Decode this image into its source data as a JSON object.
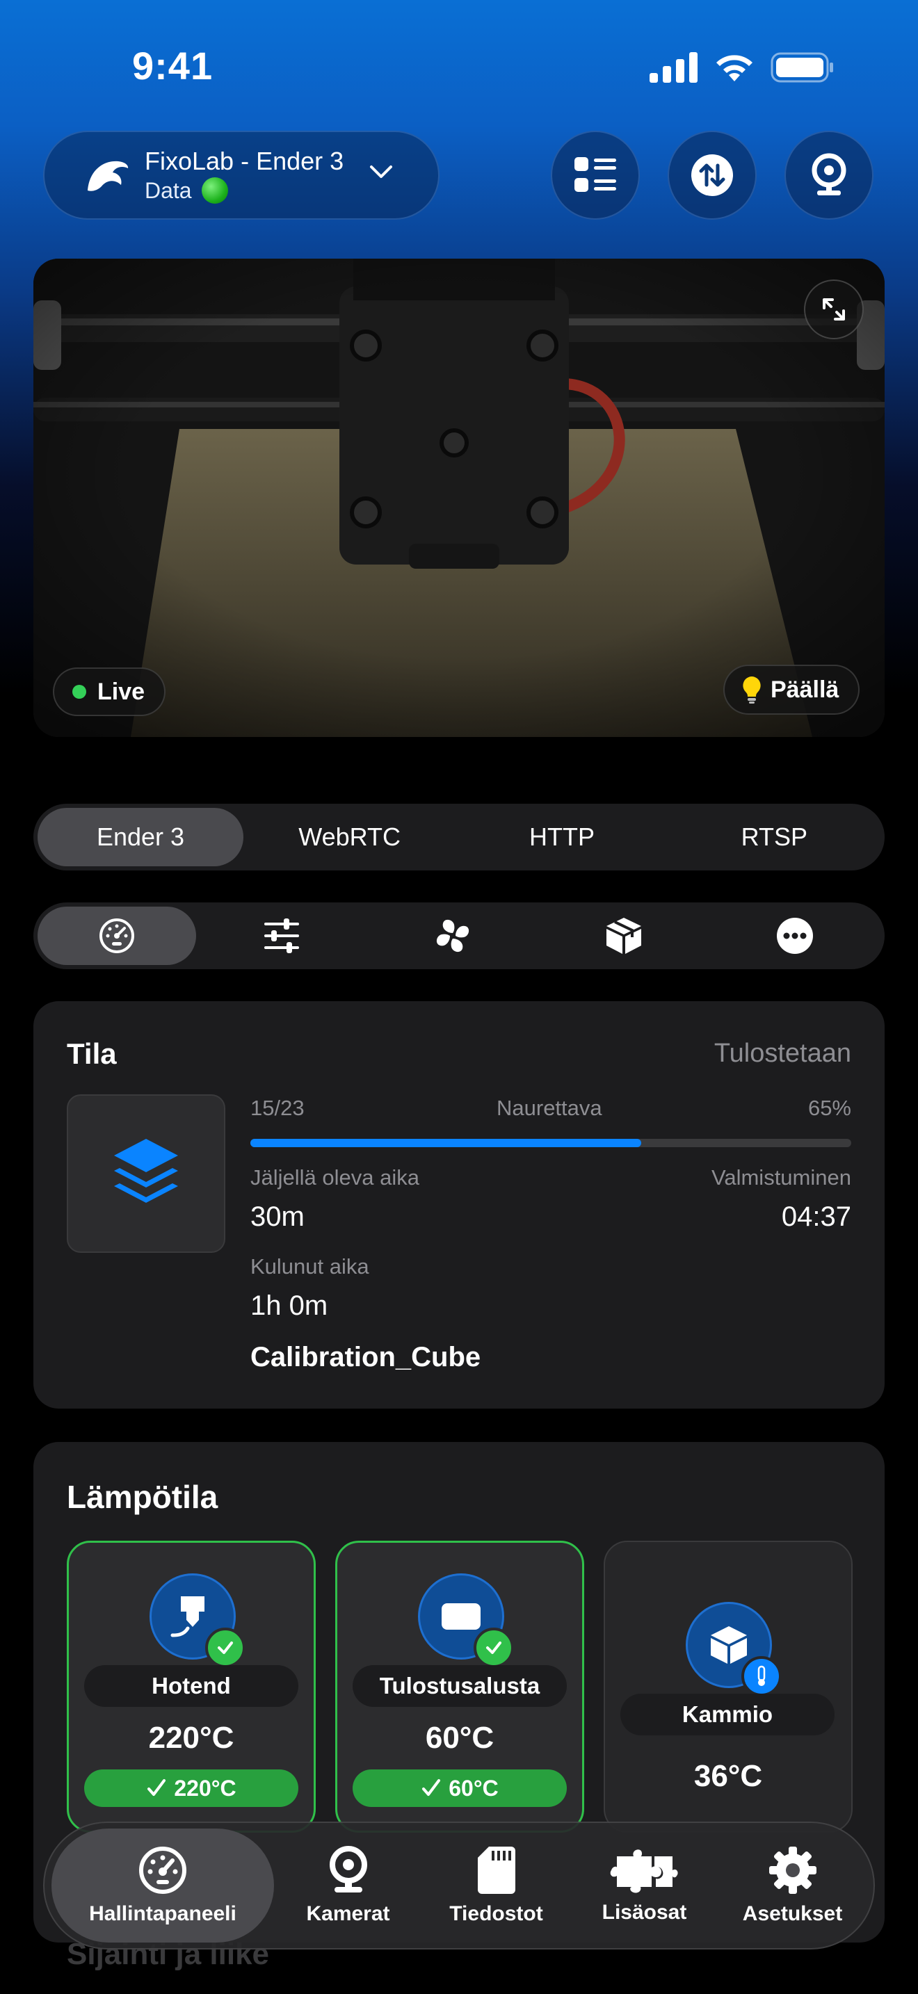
{
  "status_bar": {
    "time": "9:41"
  },
  "printer": {
    "name": "FixoLab - Ender 3",
    "sub": "Data"
  },
  "camera": {
    "live_label": "Live",
    "light_label": "Päällä"
  },
  "sources": [
    "Ender 3",
    "WebRTC",
    "HTTP",
    "RTSP"
  ],
  "tools": [
    "gauge-icon",
    "sliders-icon",
    "fan-icon",
    "box-icon",
    "more-icon"
  ],
  "status": {
    "title": "Tila",
    "state": "Tulostetaan",
    "layers": "15/23",
    "layer_label": "Naurettava",
    "progress_text": "65%",
    "progress": 0.65,
    "remaining_label": "Jäljellä oleva aika",
    "remaining": "30m",
    "finish_label": "Valmistuminen",
    "finish": "04:37",
    "elapsed_label": "Kulunut aika",
    "elapsed": "1h 0m",
    "file": "Calibration_Cube"
  },
  "temperature": {
    "title": "Lämpötila",
    "hotend": {
      "name": "Hotend",
      "value": "220°C",
      "target": "220°C"
    },
    "bed": {
      "name": "Tulostusalusta",
      "value": "60°C",
      "target": "60°C"
    },
    "chamber": {
      "name": "Kammio",
      "value": "36°C"
    }
  },
  "next_section": "Sijainti ja liike",
  "tabs": [
    {
      "label": "Hallintapaneeli",
      "icon": "gauge-icon"
    },
    {
      "label": "Kamerat",
      "icon": "webcam-icon"
    },
    {
      "label": "Tiedostot",
      "icon": "sdcard-icon"
    },
    {
      "label": "Lisäosat",
      "icon": "puzzle-icon"
    },
    {
      "label": "Asetukset",
      "icon": "gear-icon"
    }
  ],
  "colors": {
    "accent": "#0a84ff",
    "success": "#30c04a",
    "card": "#1c1c1e"
  }
}
